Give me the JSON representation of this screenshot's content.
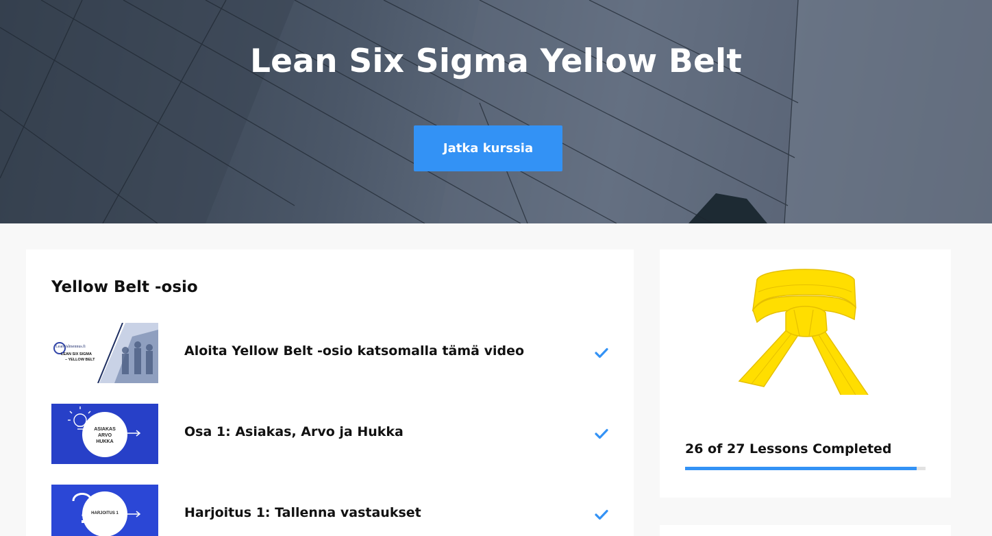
{
  "hero": {
    "title": "Lean Six Sigma Yellow Belt",
    "button_label": "Jatka kurssia"
  },
  "section": {
    "title": "Yellow Belt -osio"
  },
  "lessons": [
    {
      "title": "Aloita Yellow Belt -osio katsomalla tämä video",
      "completed": true,
      "thumb": {
        "brand": "LeanValmennus.fi",
        "line1": "LEAN SIX SIGMA",
        "line2": "– YELLOW BELT"
      }
    },
    {
      "title": "Osa 1: Asiakas, Arvo ja Hukka",
      "completed": true,
      "thumb": {
        "line1": "ASIAKAS",
        "line2": "ARVO",
        "line3": "HUKKA",
        "icon": "lightbulb-icon"
      }
    },
    {
      "title": "Harjoitus 1: Tallenna vastaukset",
      "completed": true,
      "thumb": {
        "line1": "HARJOITUS 1",
        "icon": "question-mark-icon"
      }
    }
  ],
  "progress": {
    "label": "26 of 27 Lessons Completed",
    "completed": 26,
    "total": 27
  },
  "colors": {
    "accent": "#3392f5",
    "belt": "#ffde00",
    "thumb_blue": "#2b47d6"
  }
}
